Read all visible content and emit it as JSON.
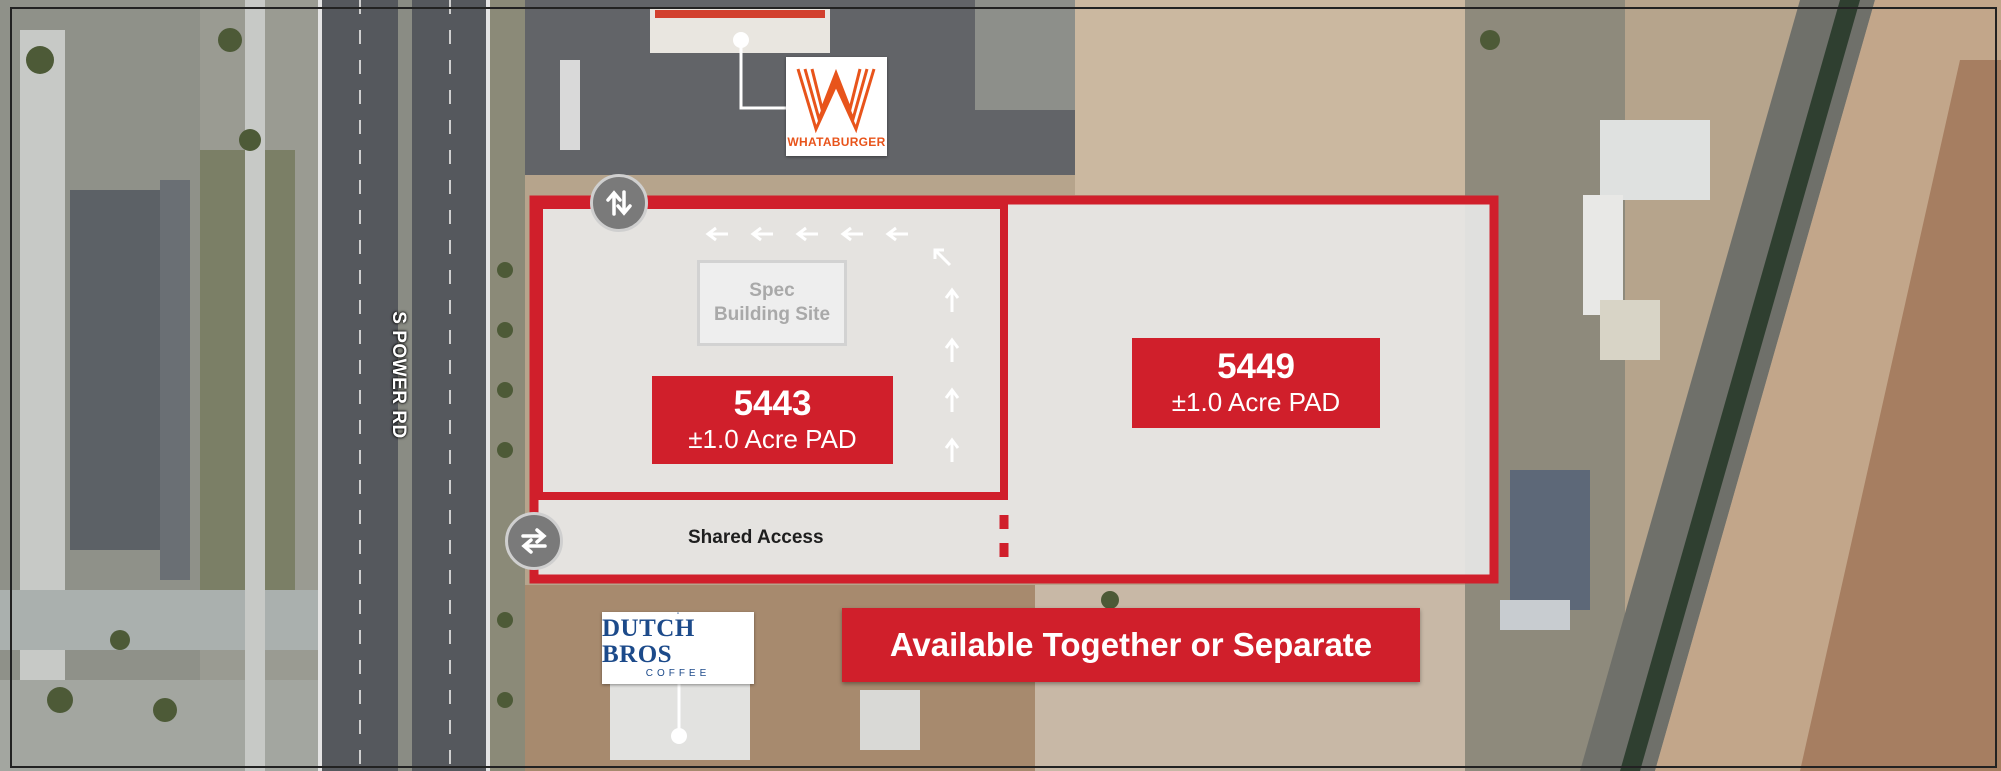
{
  "map": {
    "road_label": "S POWER RD",
    "spec_site": {
      "line1": "Spec",
      "line2": "Building Site"
    },
    "parcels": [
      {
        "number": "5443",
        "size": "±1.0 Acre PAD"
      },
      {
        "number": "5449",
        "size": "±1.0 Acre PAD"
      }
    ],
    "shared_access_label": "Shared Access",
    "availability_banner": "Available Together or Separate",
    "tenants": {
      "whataburger": {
        "logo_text": "WHATABURGER"
      },
      "dutch_bros": {
        "logo_name": "DUTCH BROS",
        "logo_sub": "COFFEE"
      }
    },
    "icons": [
      "two-way-traffic-icon",
      "two-way-traffic-icon",
      "direction-arrow-icon"
    ],
    "colors": {
      "accent_red": "#d01f2b",
      "whataburger_orange": "#e8541b",
      "dutch_bros_blue": "#1c4a8a",
      "access_icon_gray": "#7a7a7a"
    }
  }
}
